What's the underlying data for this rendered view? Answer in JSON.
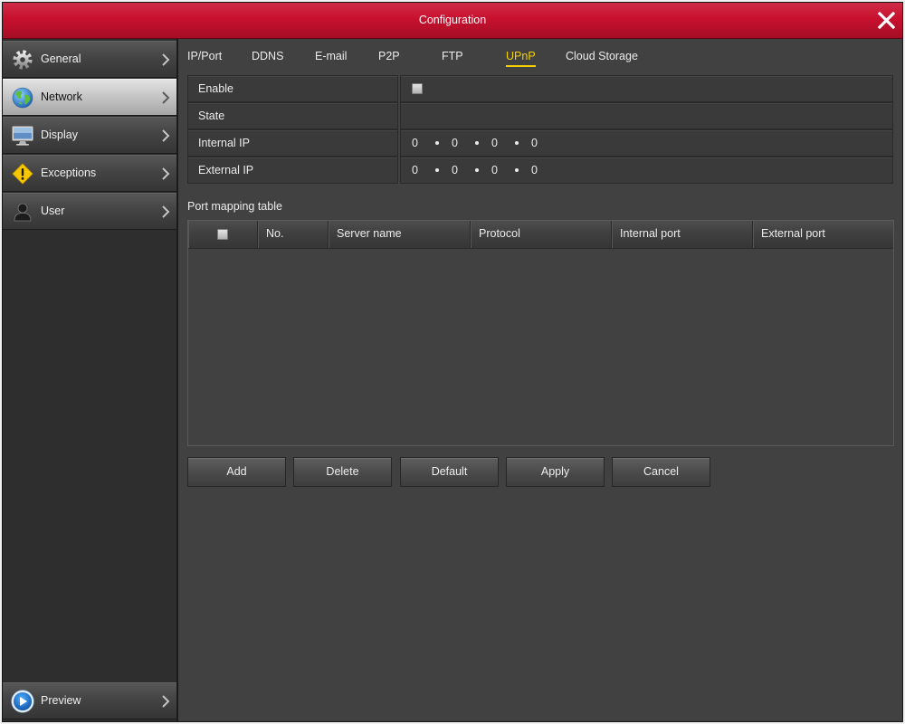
{
  "window": {
    "title": "Configuration",
    "close_icon": "close-icon"
  },
  "sidebar": {
    "items": [
      {
        "label": "General",
        "icon": "gear-icon",
        "selected": false
      },
      {
        "label": "Network",
        "icon": "globe-icon",
        "selected": true
      },
      {
        "label": "Display",
        "icon": "monitor-icon",
        "selected": false
      },
      {
        "label": "Exceptions",
        "icon": "warning-icon",
        "selected": false
      },
      {
        "label": "User",
        "icon": "user-icon",
        "selected": false
      }
    ],
    "footer": {
      "label": "Preview",
      "icon": "play-icon"
    }
  },
  "tabs": [
    {
      "label": "IP/Port",
      "active": false
    },
    {
      "label": "DDNS",
      "active": false
    },
    {
      "label": "E-mail",
      "active": false
    },
    {
      "label": "P2P",
      "active": false
    },
    {
      "label": "FTP",
      "active": false
    },
    {
      "label": "UPnP",
      "active": true
    },
    {
      "label": "Cloud Storage",
      "active": false
    }
  ],
  "upnp": {
    "enable": {
      "label": "Enable",
      "checked": false
    },
    "state": {
      "label": "State",
      "value": ""
    },
    "internal_ip": {
      "label": "Internal IP",
      "octets": [
        "0",
        "0",
        "0",
        "0"
      ]
    },
    "external_ip": {
      "label": "External IP",
      "octets": [
        "0",
        "0",
        "0",
        "0"
      ]
    }
  },
  "port_mapping": {
    "title": "Port mapping table",
    "select_all_checked": false,
    "columns": [
      "No.",
      "Server name",
      "Protocol",
      "Internal port",
      "External port"
    ],
    "rows": []
  },
  "buttons": {
    "add": "Add",
    "delete": "Delete",
    "default": "Default",
    "apply": "Apply",
    "cancel": "Cancel"
  },
  "colors": {
    "title_bar": "#c8102e",
    "active_tab": "#f5d000",
    "selected_item": "#c4c4c4",
    "background": "#414141"
  }
}
